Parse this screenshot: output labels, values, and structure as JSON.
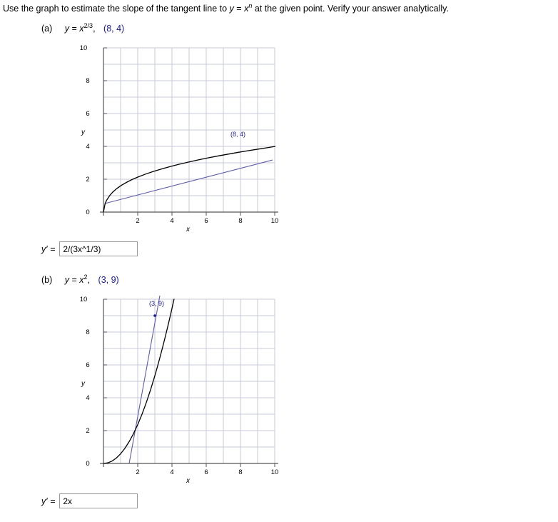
{
  "prompt": {
    "before": "Use the graph to estimate the slope of the tangent line to ",
    "func_y": "y",
    "func_eq": " = ",
    "func_x": "x",
    "func_exp": "n",
    "after": " at the given point. Verify your answer analytically."
  },
  "parts": [
    {
      "id": "a",
      "label": "(a)",
      "y": "y",
      "equals": "=",
      "base": "x",
      "exponent": "2/3",
      "comma": ",",
      "point": "(8, 4)",
      "answer_label": "y′ =",
      "answer_value": "2/(3x^1/3)",
      "graph": {
        "xlabel": "x",
        "ylabel": "y",
        "x_ticks": [
          "2",
          "4",
          "6",
          "8",
          "10"
        ],
        "y_ticks": [
          "0",
          "2",
          "4",
          "6",
          "8",
          "10"
        ],
        "point_label": "(8, 4)"
      }
    },
    {
      "id": "b",
      "label": "(b)",
      "y": "y",
      "equals": "=",
      "base": "x",
      "exponent": "2",
      "comma": ",",
      "point": "(3, 9)",
      "answer_label": "y′ =",
      "answer_value": "2x",
      "graph": {
        "xlabel": "x",
        "ylabel": "y",
        "x_ticks": [
          "2",
          "4",
          "6",
          "8",
          "10"
        ],
        "y_ticks": [
          "0",
          "2",
          "4",
          "6",
          "8",
          "10"
        ],
        "point_label": "(3, 9)"
      }
    }
  ],
  "colors": {
    "grid": "#c9c9d8",
    "axis": "#555555",
    "curve": "#000000",
    "tangent": "#5c5ca8",
    "point_text": "#1a1a8c"
  }
}
